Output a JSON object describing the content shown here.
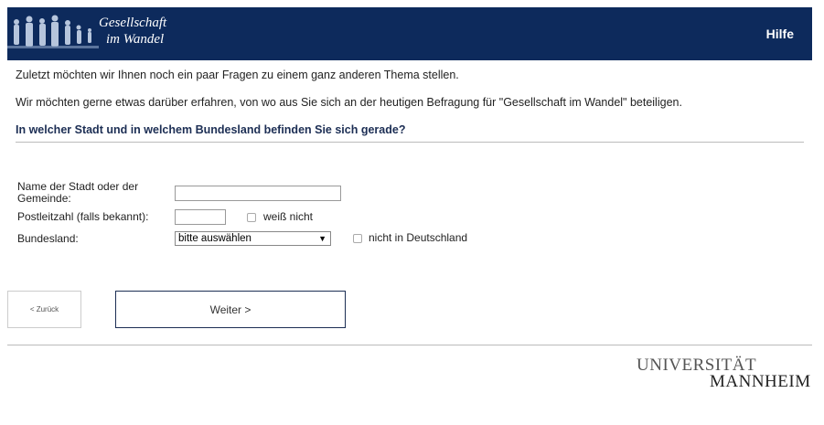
{
  "header": {
    "logo_line1": "Gesellschaft",
    "logo_line2": "im Wandel",
    "help_label": "Hilfe"
  },
  "intro": {
    "line1": "Zuletzt möchten wir Ihnen noch ein paar Fragen zu einem ganz anderen Thema stellen.",
    "line2": "Wir möchten gerne etwas darüber erfahren, von wo aus Sie sich an der heutigen Befragung für \"Gesellschaft im Wandel\" beteiligen."
  },
  "question": "In welcher Stadt und in welchem Bundesland befinden Sie sich gerade?",
  "form": {
    "city_label_1": "Name der Stadt oder der",
    "city_label_2": "Gemeinde:",
    "city_value": "",
    "zip_label": "Postleitzahl (falls bekannt):",
    "zip_value": "",
    "zip_unknown_label": "weiß nicht",
    "state_label": "Bundesland:",
    "state_selected": "bitte auswählen",
    "not_germany_label": "nicht in Deutschland"
  },
  "nav": {
    "back_label": "< Zurück",
    "next_label": "Weiter >"
  },
  "footer": {
    "uni_line1": "UNIVERSITÄT",
    "uni_line2": "MANNHEIM"
  }
}
